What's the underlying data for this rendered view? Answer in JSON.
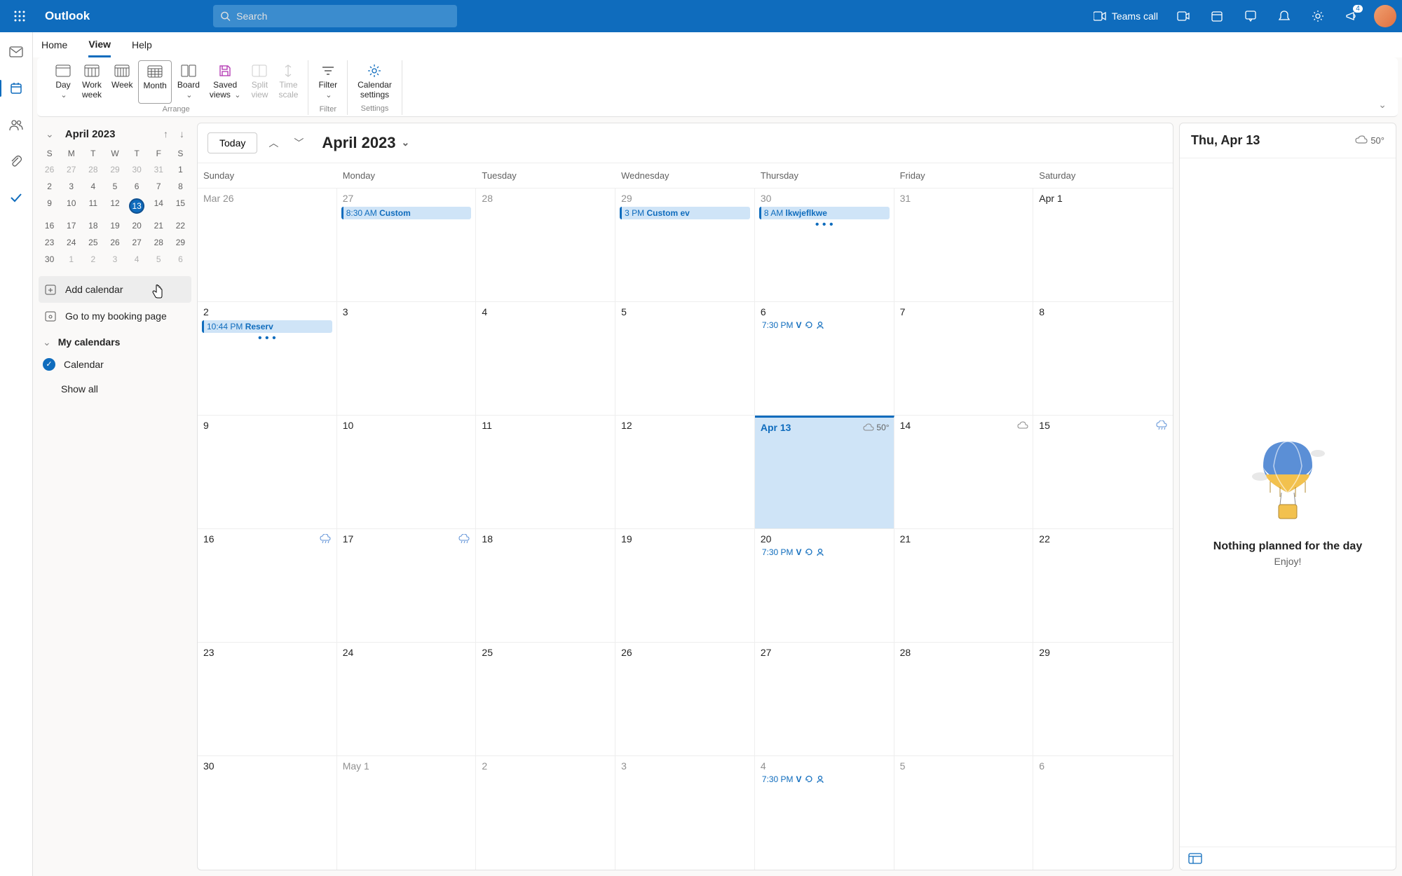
{
  "topbar": {
    "brand": "Outlook",
    "search_placeholder": "Search",
    "teams_call": "Teams call",
    "notif_badge": "4"
  },
  "tabs": {
    "home": "Home",
    "view": "View",
    "help": "Help"
  },
  "ribbon": {
    "day": "Day",
    "work_week": "Work\nweek",
    "week": "Week",
    "month": "Month",
    "board": "Board",
    "saved_views": "Saved\nviews",
    "split_view": "Split\nview",
    "time_scale": "Time\nscale",
    "filter": "Filter",
    "calendar_settings": "Calendar\nsettings",
    "group_arrange": "Arrange",
    "group_filter": "Filter",
    "group_settings": "Settings"
  },
  "mini": {
    "title": "April 2023",
    "dows": [
      "S",
      "M",
      "T",
      "W",
      "T",
      "F",
      "S"
    ],
    "days": [
      {
        "n": "26",
        "out": true
      },
      {
        "n": "27",
        "out": true
      },
      {
        "n": "28",
        "out": true
      },
      {
        "n": "29",
        "out": true
      },
      {
        "n": "30",
        "out": true
      },
      {
        "n": "31",
        "out": true
      },
      {
        "n": "1"
      },
      {
        "n": "2"
      },
      {
        "n": "3"
      },
      {
        "n": "4"
      },
      {
        "n": "5"
      },
      {
        "n": "6"
      },
      {
        "n": "7"
      },
      {
        "n": "8"
      },
      {
        "n": "9"
      },
      {
        "n": "10"
      },
      {
        "n": "11"
      },
      {
        "n": "12"
      },
      {
        "n": "13",
        "today": true
      },
      {
        "n": "14"
      },
      {
        "n": "15"
      },
      {
        "n": "16"
      },
      {
        "n": "17"
      },
      {
        "n": "18"
      },
      {
        "n": "19"
      },
      {
        "n": "20"
      },
      {
        "n": "21"
      },
      {
        "n": "22"
      },
      {
        "n": "23"
      },
      {
        "n": "24"
      },
      {
        "n": "25"
      },
      {
        "n": "26"
      },
      {
        "n": "27"
      },
      {
        "n": "28"
      },
      {
        "n": "29"
      },
      {
        "n": "30"
      },
      {
        "n": "1",
        "out": true
      },
      {
        "n": "2",
        "out": true
      },
      {
        "n": "3",
        "out": true
      },
      {
        "n": "4",
        "out": true
      },
      {
        "n": "5",
        "out": true
      },
      {
        "n": "6",
        "out": true
      }
    ]
  },
  "side": {
    "add_calendar": "Add calendar",
    "booking": "Go to my booking page",
    "my_calendars": "My calendars",
    "calendar_item": "Calendar",
    "show_all": "Show all"
  },
  "cal": {
    "today_btn": "Today",
    "title": "April 2023",
    "dows": [
      "Sunday",
      "Monday",
      "Tuesday",
      "Wednesday",
      "Thursday",
      "Friday",
      "Saturday"
    ],
    "weeks": [
      [
        {
          "label": "Mar 26",
          "out": true
        },
        {
          "label": "27",
          "out": true,
          "events": [
            {
              "time": "8:30 AM",
              "title": "Custom"
            }
          ]
        },
        {
          "label": "28",
          "out": true
        },
        {
          "label": "29",
          "out": true,
          "events": [
            {
              "time": "3 PM",
              "title": "Custom ev"
            }
          ]
        },
        {
          "label": "30",
          "out": true,
          "events": [
            {
              "time": "8 AM",
              "title": "lkwjeflkwe"
            }
          ],
          "more": true
        },
        {
          "label": "31",
          "out": true
        },
        {
          "label": "Apr 1"
        }
      ],
      [
        {
          "label": "2",
          "events": [
            {
              "time": "10:44 PM",
              "title": "Reserv"
            }
          ],
          "more": true
        },
        {
          "label": "3"
        },
        {
          "label": "4"
        },
        {
          "label": "5"
        },
        {
          "label": "6",
          "mini_events": [
            {
              "time": "7:30 PM",
              "title": "V",
              "recur": true,
              "person": true
            }
          ]
        },
        {
          "label": "7"
        },
        {
          "label": "8"
        }
      ],
      [
        {
          "label": "9"
        },
        {
          "label": "10"
        },
        {
          "label": "11"
        },
        {
          "label": "12"
        },
        {
          "label": "Apr 13",
          "today": true,
          "weather": "50°"
        },
        {
          "label": "14",
          "weather_icon": true
        },
        {
          "label": "15",
          "weather_icon": true,
          "weather_rain": true
        }
      ],
      [
        {
          "label": "16",
          "weather_icon": true,
          "weather_rain": true
        },
        {
          "label": "17",
          "weather_icon": true,
          "weather_rain": true
        },
        {
          "label": "18"
        },
        {
          "label": "19"
        },
        {
          "label": "20",
          "mini_events": [
            {
              "time": "7:30 PM",
              "title": "V",
              "recur": true,
              "person": true
            }
          ]
        },
        {
          "label": "21"
        },
        {
          "label": "22"
        }
      ],
      [
        {
          "label": "23"
        },
        {
          "label": "24"
        },
        {
          "label": "25"
        },
        {
          "label": "26"
        },
        {
          "label": "27"
        },
        {
          "label": "28"
        },
        {
          "label": "29"
        }
      ],
      [
        {
          "label": "30"
        },
        {
          "label": "May 1",
          "out": true
        },
        {
          "label": "2",
          "out": true
        },
        {
          "label": "3",
          "out": true
        },
        {
          "label": "4",
          "out": true,
          "mini_events": [
            {
              "time": "7:30 PM",
              "title": "V",
              "recur": true,
              "person": true
            }
          ]
        },
        {
          "label": "5",
          "out": true
        },
        {
          "label": "6",
          "out": true
        }
      ]
    ]
  },
  "right": {
    "date": "Thu, Apr 13",
    "temp": "50°",
    "heading": "Nothing planned for the day",
    "sub": "Enjoy!"
  }
}
